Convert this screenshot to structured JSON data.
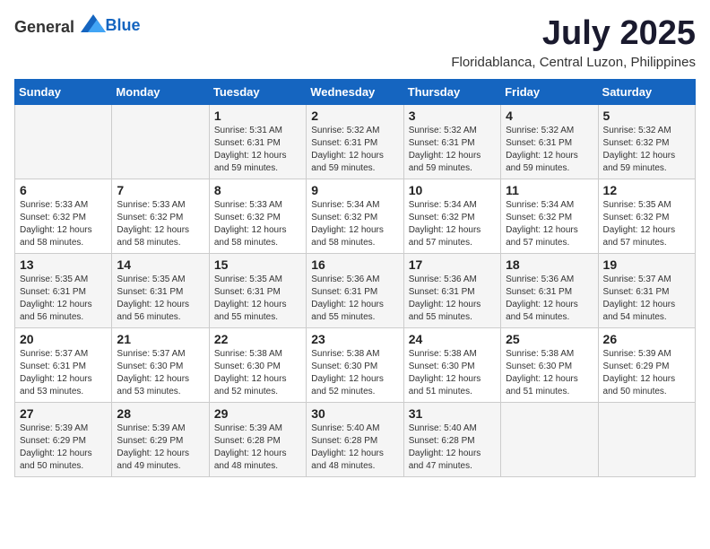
{
  "header": {
    "logo_general": "General",
    "logo_blue": "Blue",
    "month_year": "July 2025",
    "location": "Floridablanca, Central Luzon, Philippines"
  },
  "weekdays": [
    "Sunday",
    "Monday",
    "Tuesday",
    "Wednesday",
    "Thursday",
    "Friday",
    "Saturday"
  ],
  "weeks": [
    [
      {
        "day": "",
        "sunrise": "",
        "sunset": "",
        "daylight": ""
      },
      {
        "day": "",
        "sunrise": "",
        "sunset": "",
        "daylight": ""
      },
      {
        "day": "1",
        "sunrise": "Sunrise: 5:31 AM",
        "sunset": "Sunset: 6:31 PM",
        "daylight": "Daylight: 12 hours and 59 minutes."
      },
      {
        "day": "2",
        "sunrise": "Sunrise: 5:32 AM",
        "sunset": "Sunset: 6:31 PM",
        "daylight": "Daylight: 12 hours and 59 minutes."
      },
      {
        "day": "3",
        "sunrise": "Sunrise: 5:32 AM",
        "sunset": "Sunset: 6:31 PM",
        "daylight": "Daylight: 12 hours and 59 minutes."
      },
      {
        "day": "4",
        "sunrise": "Sunrise: 5:32 AM",
        "sunset": "Sunset: 6:31 PM",
        "daylight": "Daylight: 12 hours and 59 minutes."
      },
      {
        "day": "5",
        "sunrise": "Sunrise: 5:32 AM",
        "sunset": "Sunset: 6:32 PM",
        "daylight": "Daylight: 12 hours and 59 minutes."
      }
    ],
    [
      {
        "day": "6",
        "sunrise": "Sunrise: 5:33 AM",
        "sunset": "Sunset: 6:32 PM",
        "daylight": "Daylight: 12 hours and 58 minutes."
      },
      {
        "day": "7",
        "sunrise": "Sunrise: 5:33 AM",
        "sunset": "Sunset: 6:32 PM",
        "daylight": "Daylight: 12 hours and 58 minutes."
      },
      {
        "day": "8",
        "sunrise": "Sunrise: 5:33 AM",
        "sunset": "Sunset: 6:32 PM",
        "daylight": "Daylight: 12 hours and 58 minutes."
      },
      {
        "day": "9",
        "sunrise": "Sunrise: 5:34 AM",
        "sunset": "Sunset: 6:32 PM",
        "daylight": "Daylight: 12 hours and 58 minutes."
      },
      {
        "day": "10",
        "sunrise": "Sunrise: 5:34 AM",
        "sunset": "Sunset: 6:32 PM",
        "daylight": "Daylight: 12 hours and 57 minutes."
      },
      {
        "day": "11",
        "sunrise": "Sunrise: 5:34 AM",
        "sunset": "Sunset: 6:32 PM",
        "daylight": "Daylight: 12 hours and 57 minutes."
      },
      {
        "day": "12",
        "sunrise": "Sunrise: 5:35 AM",
        "sunset": "Sunset: 6:32 PM",
        "daylight": "Daylight: 12 hours and 57 minutes."
      }
    ],
    [
      {
        "day": "13",
        "sunrise": "Sunrise: 5:35 AM",
        "sunset": "Sunset: 6:31 PM",
        "daylight": "Daylight: 12 hours and 56 minutes."
      },
      {
        "day": "14",
        "sunrise": "Sunrise: 5:35 AM",
        "sunset": "Sunset: 6:31 PM",
        "daylight": "Daylight: 12 hours and 56 minutes."
      },
      {
        "day": "15",
        "sunrise": "Sunrise: 5:35 AM",
        "sunset": "Sunset: 6:31 PM",
        "daylight": "Daylight: 12 hours and 55 minutes."
      },
      {
        "day": "16",
        "sunrise": "Sunrise: 5:36 AM",
        "sunset": "Sunset: 6:31 PM",
        "daylight": "Daylight: 12 hours and 55 minutes."
      },
      {
        "day": "17",
        "sunrise": "Sunrise: 5:36 AM",
        "sunset": "Sunset: 6:31 PM",
        "daylight": "Daylight: 12 hours and 55 minutes."
      },
      {
        "day": "18",
        "sunrise": "Sunrise: 5:36 AM",
        "sunset": "Sunset: 6:31 PM",
        "daylight": "Daylight: 12 hours and 54 minutes."
      },
      {
        "day": "19",
        "sunrise": "Sunrise: 5:37 AM",
        "sunset": "Sunset: 6:31 PM",
        "daylight": "Daylight: 12 hours and 54 minutes."
      }
    ],
    [
      {
        "day": "20",
        "sunrise": "Sunrise: 5:37 AM",
        "sunset": "Sunset: 6:31 PM",
        "daylight": "Daylight: 12 hours and 53 minutes."
      },
      {
        "day": "21",
        "sunrise": "Sunrise: 5:37 AM",
        "sunset": "Sunset: 6:30 PM",
        "daylight": "Daylight: 12 hours and 53 minutes."
      },
      {
        "day": "22",
        "sunrise": "Sunrise: 5:38 AM",
        "sunset": "Sunset: 6:30 PM",
        "daylight": "Daylight: 12 hours and 52 minutes."
      },
      {
        "day": "23",
        "sunrise": "Sunrise: 5:38 AM",
        "sunset": "Sunset: 6:30 PM",
        "daylight": "Daylight: 12 hours and 52 minutes."
      },
      {
        "day": "24",
        "sunrise": "Sunrise: 5:38 AM",
        "sunset": "Sunset: 6:30 PM",
        "daylight": "Daylight: 12 hours and 51 minutes."
      },
      {
        "day": "25",
        "sunrise": "Sunrise: 5:38 AM",
        "sunset": "Sunset: 6:30 PM",
        "daylight": "Daylight: 12 hours and 51 minutes."
      },
      {
        "day": "26",
        "sunrise": "Sunrise: 5:39 AM",
        "sunset": "Sunset: 6:29 PM",
        "daylight": "Daylight: 12 hours and 50 minutes."
      }
    ],
    [
      {
        "day": "27",
        "sunrise": "Sunrise: 5:39 AM",
        "sunset": "Sunset: 6:29 PM",
        "daylight": "Daylight: 12 hours and 50 minutes."
      },
      {
        "day": "28",
        "sunrise": "Sunrise: 5:39 AM",
        "sunset": "Sunset: 6:29 PM",
        "daylight": "Daylight: 12 hours and 49 minutes."
      },
      {
        "day": "29",
        "sunrise": "Sunrise: 5:39 AM",
        "sunset": "Sunset: 6:28 PM",
        "daylight": "Daylight: 12 hours and 48 minutes."
      },
      {
        "day": "30",
        "sunrise": "Sunrise: 5:40 AM",
        "sunset": "Sunset: 6:28 PM",
        "daylight": "Daylight: 12 hours and 48 minutes."
      },
      {
        "day": "31",
        "sunrise": "Sunrise: 5:40 AM",
        "sunset": "Sunset: 6:28 PM",
        "daylight": "Daylight: 12 hours and 47 minutes."
      },
      {
        "day": "",
        "sunrise": "",
        "sunset": "",
        "daylight": ""
      },
      {
        "day": "",
        "sunrise": "",
        "sunset": "",
        "daylight": ""
      }
    ]
  ]
}
